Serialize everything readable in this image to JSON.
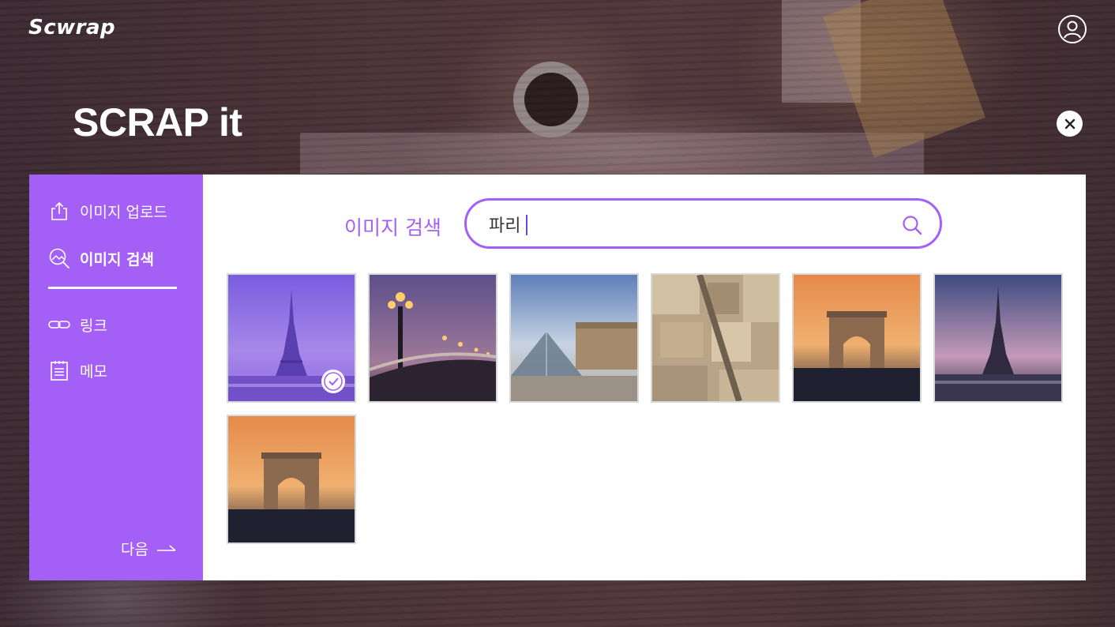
{
  "app": {
    "logo": "Scwrap"
  },
  "header": {
    "headline": "SCRAP it"
  },
  "sidebar": {
    "items": [
      {
        "label": "이미지 업로드",
        "icon": "upload-icon",
        "active": false
      },
      {
        "label": "이미지 검색",
        "icon": "image-search-icon",
        "active": true
      },
      {
        "label": "링크",
        "icon": "link-icon",
        "active": false
      },
      {
        "label": "메모",
        "icon": "memo-icon",
        "active": false
      }
    ],
    "next_label": "다음",
    "next_icon": "arrow-right-icon"
  },
  "search": {
    "label": "이미지 검색",
    "value": "파리",
    "icon": "search-icon"
  },
  "results": [
    {
      "subject": "Eiffel Tower (purple tint)",
      "selected": true
    },
    {
      "subject": "Pont Alexandre III lamps at dusk",
      "selected": false
    },
    {
      "subject": "Louvre pyramid",
      "selected": false
    },
    {
      "subject": "Paris rooftops aerial",
      "selected": false
    },
    {
      "subject": "Arc de Triomphe at sunset",
      "selected": false
    },
    {
      "subject": "Eiffel Tower at dusk",
      "selected": false
    },
    {
      "subject": "Arc de Triomphe at sunset",
      "selected": false
    }
  ],
  "colors": {
    "accent": "#a45ff7",
    "panel": "#ffffff",
    "background": "#3a2a2e"
  }
}
